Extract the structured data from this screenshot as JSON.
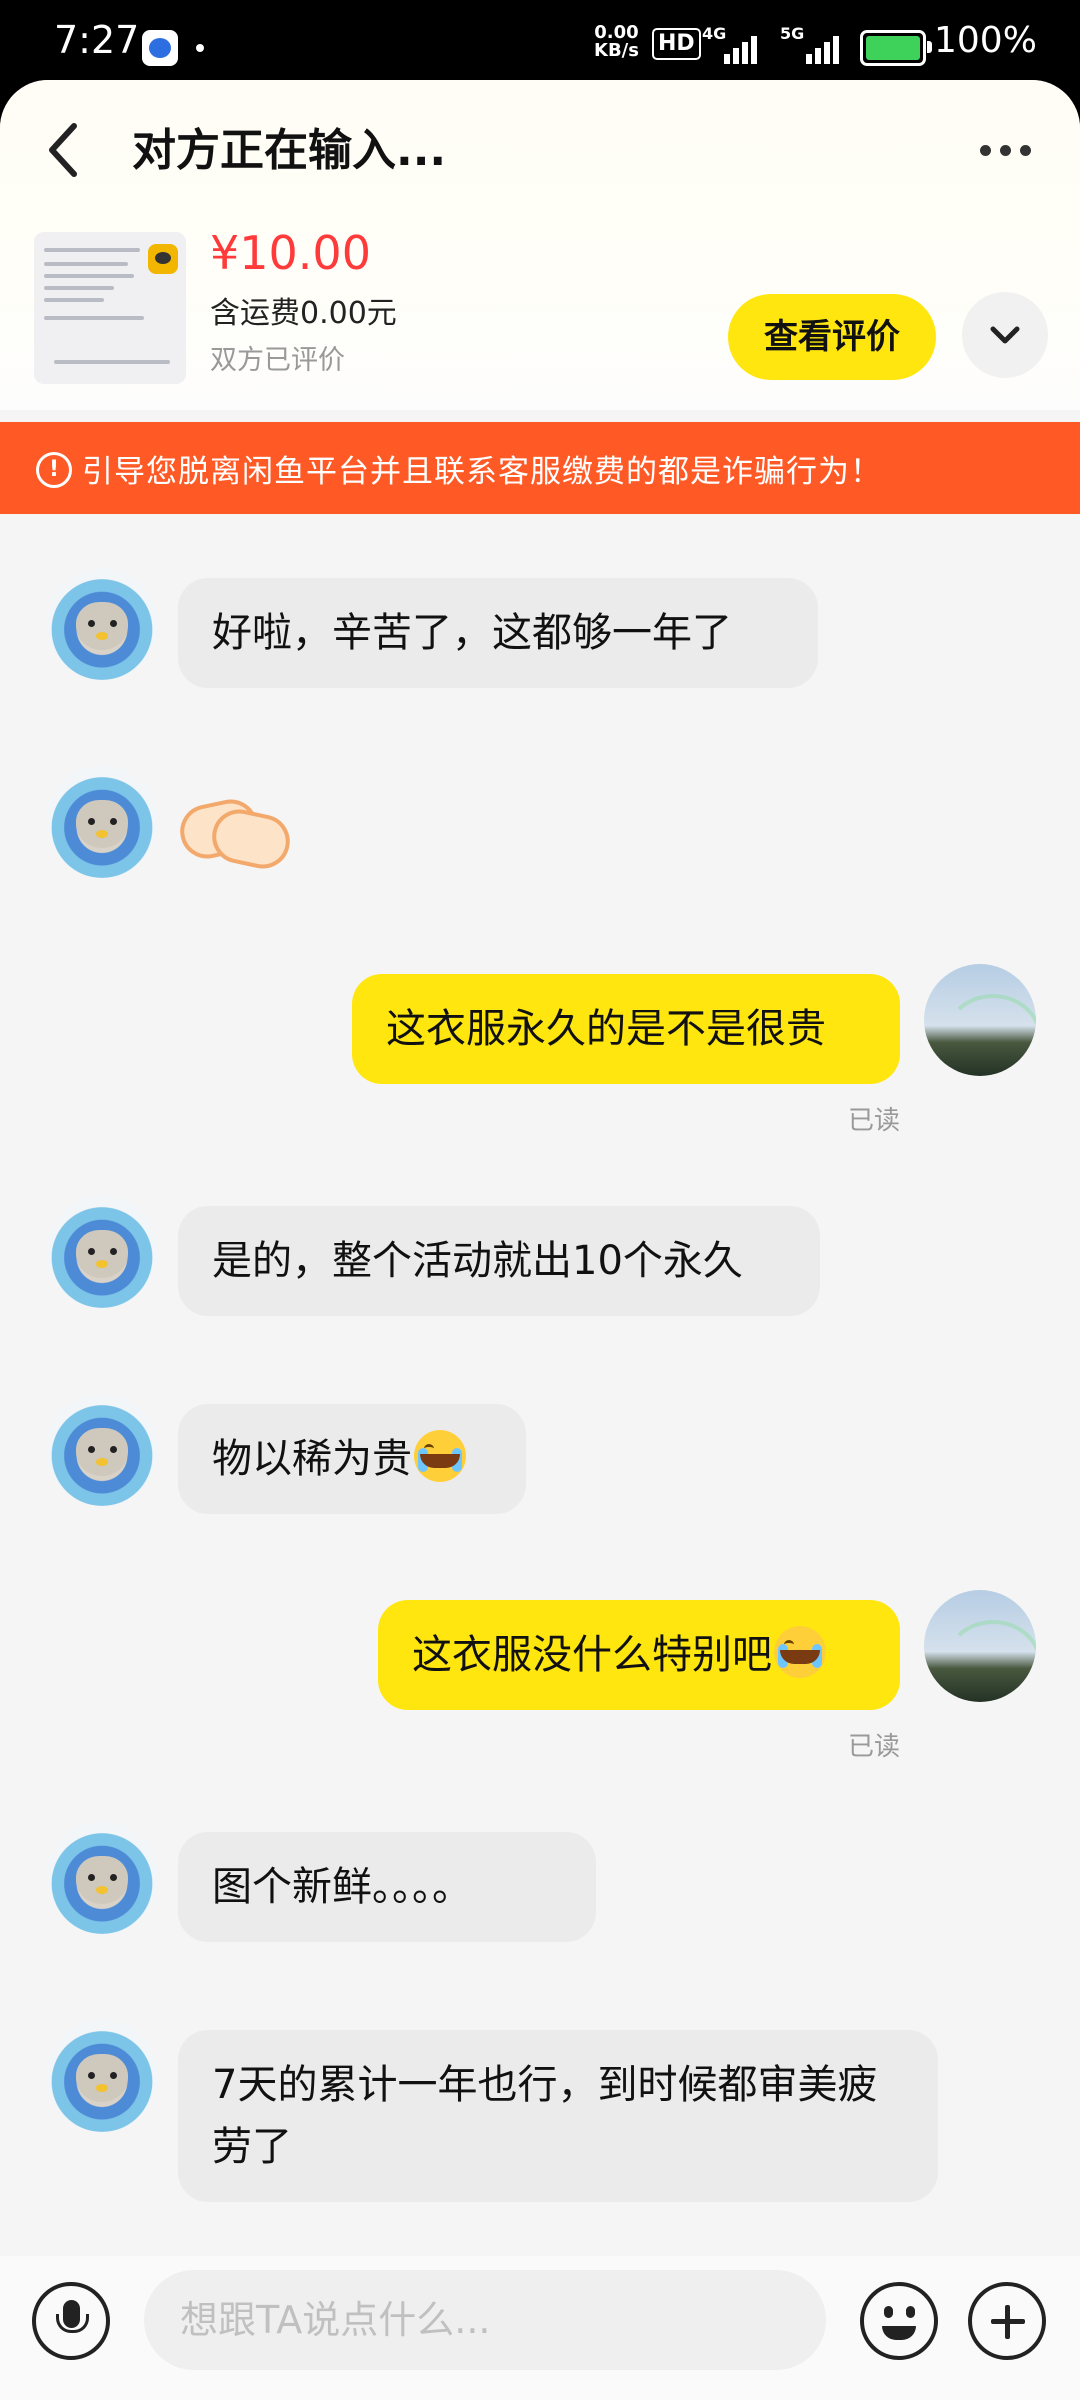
{
  "status_bar": {
    "time": "7:27",
    "net_speed_value": "0.00",
    "net_speed_unit": "KB/s",
    "hd_label": "HD",
    "sig1_label": "4G",
    "sig2_label": "5G",
    "battery_percent": "100%"
  },
  "header": {
    "title": "对方正在输入..."
  },
  "product": {
    "price": "¥10.00",
    "shipping": "含运费0.00元",
    "review_status": "双方已评价",
    "review_button": "查看评价"
  },
  "warning": {
    "text": "引导您脱离闲鱼平台并且联系客服缴费的都是诈骗行为！"
  },
  "messages": [
    {
      "from": "other",
      "text": "好啦，辛苦了，这都够一年了"
    },
    {
      "from": "other",
      "emoji": "handshake-emoji"
    },
    {
      "from": "me",
      "text": "这衣服永久的是不是很贵",
      "status": "已读"
    },
    {
      "from": "other",
      "text": "是的，整个活动就出10个永久"
    },
    {
      "from": "other",
      "text": "物以稀为贵",
      "emoji": "loudly-crying-emoji"
    },
    {
      "from": "me",
      "text": "这衣服没什么特别吧",
      "emoji": "loudly-crying-emoji",
      "status": "已读"
    },
    {
      "from": "other",
      "text": "图个新鲜。。。。"
    },
    {
      "from": "other",
      "text": "7天的累计一年也行，到时候都审美疲劳了"
    }
  ],
  "input": {
    "placeholder": "想跟TA说点什么..."
  },
  "icons": {
    "back": "chevron-left-icon",
    "more": "more-dots-icon",
    "expand": "chevron-down-icon",
    "warning": "exclamation-circle-icon",
    "mic": "microphone-icon",
    "emoji": "smiley-icon",
    "plus": "plus-icon"
  },
  "colors": {
    "accent_yellow": "#ffe60f",
    "warning_orange": "#ff5a26",
    "price_red": "#ff3a3a"
  }
}
